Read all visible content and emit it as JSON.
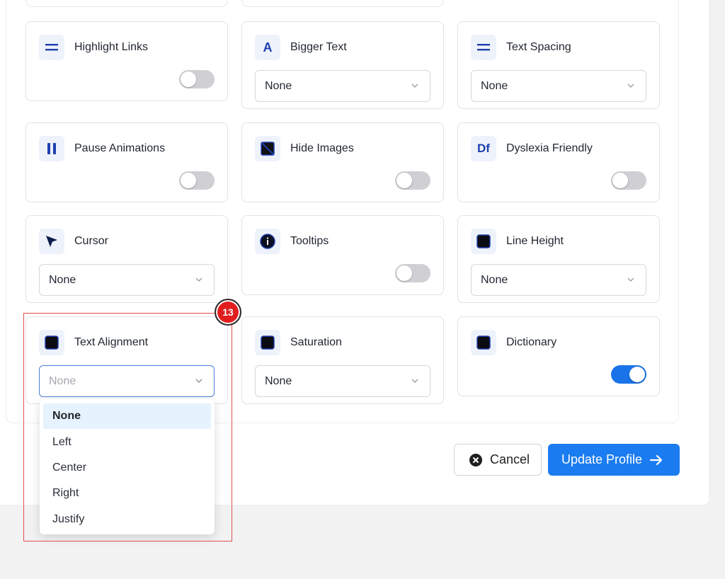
{
  "cards": {
    "highlight_links": {
      "title": "Highlight Links",
      "icon": "equals-icon"
    },
    "bigger_text": {
      "title": "Bigger Text",
      "icon_text": "A",
      "select_value": "None"
    },
    "text_spacing": {
      "title": "Text Spacing",
      "icon": "equals-icon",
      "select_value": "None"
    },
    "pause_animations": {
      "title": "Pause Animations",
      "icon": "pause-icon"
    },
    "hide_images": {
      "title": "Hide Images",
      "icon": "hide-image-icon"
    },
    "dyslexia_friendly": {
      "title": "Dyslexia Friendly",
      "icon_text": "Df"
    },
    "cursor": {
      "title": "Cursor",
      "icon": "cursor-icon",
      "select_value": "None"
    },
    "tooltips": {
      "title": "Tooltips",
      "icon": "info-icon"
    },
    "line_height": {
      "title": "Line Height",
      "icon": "square-icon",
      "select_value": "None"
    },
    "text_alignment": {
      "title": "Text Alignment",
      "icon": "square-icon",
      "select_value": "None"
    },
    "saturation": {
      "title": "Saturation",
      "icon": "square-icon",
      "select_value": "None"
    },
    "dictionary": {
      "title": "Dictionary",
      "icon": "square-icon",
      "toggle_on": true
    }
  },
  "dropdown": {
    "options": [
      "None",
      "Left",
      "Center",
      "Right",
      "Justify"
    ],
    "selected": "None"
  },
  "annotation": {
    "badge": "13",
    "color": "#e11d1d"
  },
  "buttons": {
    "cancel": "Cancel",
    "update": "Update Profile"
  },
  "colors": {
    "accent": "#1a7cf0",
    "icon_blue": "#1e40af",
    "toggle_on": "#1a73e8"
  }
}
